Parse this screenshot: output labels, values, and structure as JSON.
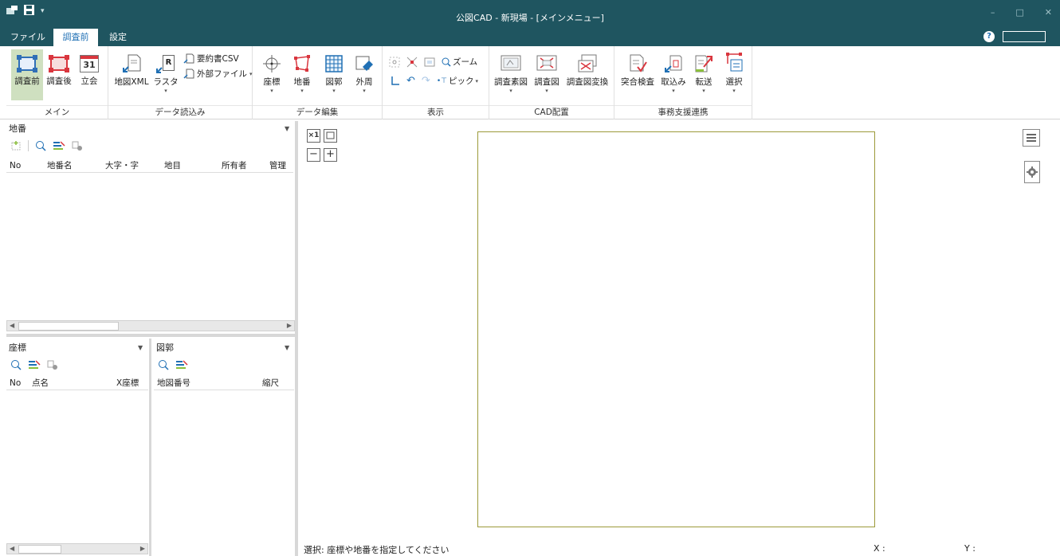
{
  "window": {
    "title": "公図CAD - 新現場 - [メインメニュー]",
    "controls": [
      "–",
      "□",
      "✕"
    ]
  },
  "menu": {
    "tabs": [
      {
        "label": "ファイル",
        "active": false
      },
      {
        "label": "調査前",
        "active": true
      },
      {
        "label": "設定",
        "active": false
      }
    ],
    "help": "?"
  },
  "ribbon": {
    "groups": {
      "main": {
        "label": "メイン",
        "buttons": {
          "before": "調査前",
          "after": "調査後",
          "witness": "立会",
          "witness_icon_text": "31"
        }
      },
      "data_import": {
        "label": "データ読込み",
        "buttons": {
          "map_xml": "地図XML",
          "raster": "ラスタ",
          "raster_icon_text": "R",
          "summary_csv": "要約書CSV",
          "external_file": "外部ファイル"
        }
      },
      "data_edit": {
        "label": "データ編集",
        "buttons": {
          "coords": "座標",
          "lot": "地番",
          "map_frame": "図郭",
          "perimeter": "外周"
        }
      },
      "display": {
        "label": "表示",
        "buttons": {
          "zoom": "ズーム",
          "pick": "ピック"
        }
      },
      "cad_layout": {
        "label": "CAD配置",
        "buttons": {
          "survey_plain": "調査素図",
          "survey": "調査図",
          "survey_convert": "調査図変換"
        }
      },
      "office_link": {
        "label": "事務支援連携",
        "buttons": {
          "match_check": "突合検査",
          "import": "取込み",
          "transfer": "転送",
          "select": "選択"
        }
      }
    }
  },
  "lot_panel": {
    "title": "地番",
    "columns": [
      "No",
      "地番名",
      "大字・字",
      "地目",
      "所有者",
      "管理"
    ]
  },
  "coord_panel": {
    "title": "座標",
    "columns": [
      "No",
      "点名",
      "X座標"
    ]
  },
  "frame_panel": {
    "title": "図郭",
    "columns": [
      "地図番号",
      "縮尺"
    ]
  },
  "canvas": {
    "controls": {
      "fit": "×1",
      "zoom_out": "−",
      "zoom_in": "+"
    }
  },
  "status": {
    "message": "選択: 座標や地番を指定してください",
    "x_label": "X :",
    "y_label": "Y :"
  },
  "colors": {
    "titlebar": "#1f5560",
    "accent": "#1f6fb4",
    "selected_button": "#cfe0c0",
    "frame": "#9c9a3a",
    "red": "#d9363e"
  }
}
